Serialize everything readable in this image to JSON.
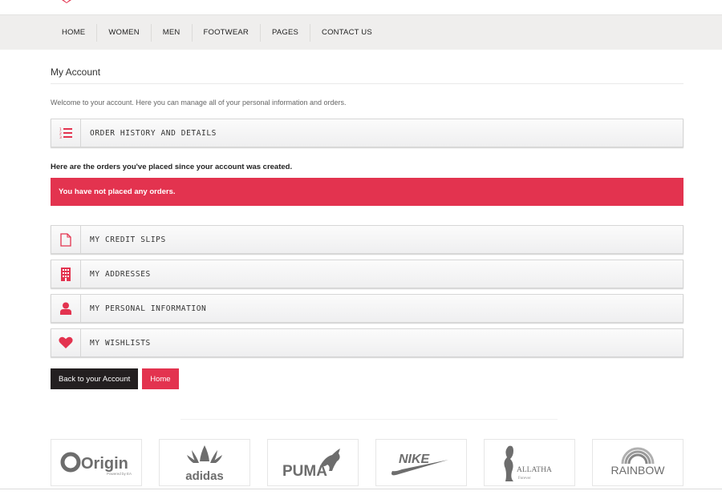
{
  "nav": {
    "items": [
      {
        "label": "HOME"
      },
      {
        "label": "WOMEN"
      },
      {
        "label": "MEN"
      },
      {
        "label": "FOOTWEAR"
      },
      {
        "label": "PAGES"
      },
      {
        "label": "CONTACT US"
      }
    ]
  },
  "page": {
    "title": "My Account",
    "welcome": "Welcome to your account. Here you can manage all of your personal information and orders."
  },
  "blocks": {
    "order_history": {
      "label": "ORDER HISTORY AND DETAILS",
      "icon": "numbered-list-icon"
    },
    "credit_slips": {
      "label": "MY CREDIT SLIPS",
      "icon": "document-icon"
    },
    "addresses": {
      "label": "MY ADDRESSES",
      "icon": "building-icon"
    },
    "personal_info": {
      "label": "MY PERSONAL INFORMATION",
      "icon": "user-icon"
    },
    "wishlists": {
      "label": "MY WISHLISTS",
      "icon": "heart-icon"
    }
  },
  "orders": {
    "note": "Here are the orders you've placed since your account was created.",
    "alert": "You have not placed any orders."
  },
  "buttons": {
    "back": "Back to your Account",
    "home": "Home"
  },
  "brands": {
    "origin": {
      "name": "Origin",
      "sub": "Powered by EA"
    },
    "adidas": {
      "name": "adidas"
    },
    "puma": {
      "name": "PUMA"
    },
    "nike": {
      "name": "NIKE"
    },
    "allatha": {
      "name": "ALLATHA",
      "sub": "Forever"
    },
    "rainbow": {
      "name": "RAINBOW"
    }
  },
  "colors": {
    "accent": "#e3334f",
    "dark_button": "#231f20",
    "nav_bg": "#efeeed"
  }
}
